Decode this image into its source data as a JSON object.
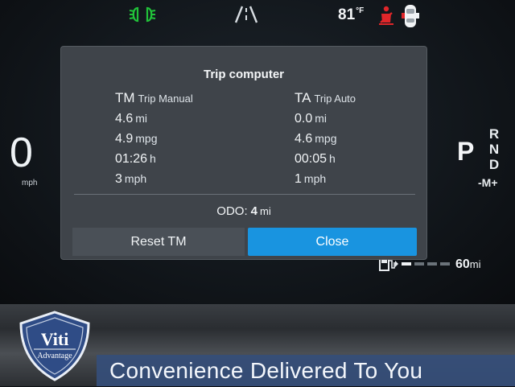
{
  "status": {
    "temperature": "81",
    "temperature_unit": "°F"
  },
  "speedometer": {
    "value": "0",
    "unit": "mph"
  },
  "gear": {
    "current": "P",
    "options": [
      "R",
      "N",
      "D"
    ],
    "manual": "-M+"
  },
  "range": {
    "value": "60",
    "unit": "mi",
    "level": 0.2
  },
  "trip_computer": {
    "title": "Trip computer",
    "tm": {
      "code": "TM",
      "label": "Trip Manual",
      "distance": "4.6",
      "distance_unit": "mi",
      "economy": "4.9",
      "economy_unit": "mpg",
      "time": "01:26",
      "time_unit": "h",
      "speed": "3",
      "speed_unit": "mph"
    },
    "ta": {
      "code": "TA",
      "label": "Trip Auto",
      "distance": "0.0",
      "distance_unit": "mi",
      "economy": "4.6",
      "economy_unit": "mpg",
      "time": "00:05",
      "time_unit": "h",
      "speed": "1",
      "speed_unit": "mph"
    },
    "odo": {
      "label": "ODO:",
      "value": "4",
      "unit": "mi"
    },
    "reset_label": "Reset TM",
    "close_label": "Close"
  },
  "watermark": {
    "logo_text": "Viti",
    "logo_subtext": "Advantage",
    "tagline": "Convenience Delivered To You"
  },
  "icons": {
    "headlight": "headlight-icon",
    "lane": "lane-assist-icon",
    "seatbelt": "seatbelt-warning-icon",
    "car": "car-doors-icon",
    "fuel": "fuel-pump-icon"
  },
  "colors": {
    "headlight": "#21c33a",
    "seatbelt": "#e0262a",
    "close_button": "#1994e0",
    "dialog": "#3f444a"
  }
}
